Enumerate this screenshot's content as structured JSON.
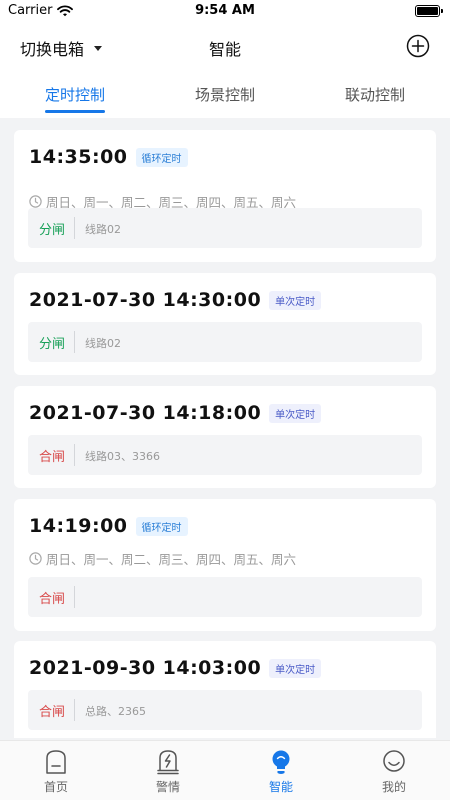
{
  "status_bar": {
    "carrier": "Carrier",
    "time": "9:54 AM"
  },
  "nav": {
    "box_switch": "切换电箱",
    "title": "智能"
  },
  "tabs": [
    {
      "label": "定时控制",
      "active": true
    },
    {
      "label": "场景控制",
      "active": false
    },
    {
      "label": "联动控制",
      "active": false
    }
  ],
  "schedules": [
    {
      "time": "14:35:00",
      "tag": "循环定时",
      "repeat": "周日、周一、周二、周三、周四、周五、周六",
      "action": "分闸",
      "lines": "线路02"
    },
    {
      "time": "2021-07-30 14:30:00",
      "tag": "单次定时",
      "action": "分闸",
      "lines": "线路02"
    },
    {
      "time": "2021-07-30 14:18:00",
      "tag": "单次定时",
      "action": "合闸",
      "lines": "线路03、3366"
    },
    {
      "time": "14:19:00",
      "tag": "循环定时",
      "repeat": "周日、周一、周二、周三、周四、周五、周六",
      "action": "合闸",
      "lines": ""
    },
    {
      "time": "2021-09-30 14:03:00",
      "tag": "单次定时",
      "action": "合闸",
      "lines": "总路、2365"
    }
  ],
  "tabbar": [
    {
      "label": "首页",
      "icon": "home-icon",
      "active": false
    },
    {
      "label": "警情",
      "icon": "alarm-icon",
      "active": false
    },
    {
      "label": "智能",
      "icon": "bulb-icon",
      "active": true
    },
    {
      "label": "我的",
      "icon": "profile-icon",
      "active": false
    }
  ],
  "colors": {
    "accent": "#1677e8",
    "open": "#18a058",
    "close": "#d84a4a"
  }
}
